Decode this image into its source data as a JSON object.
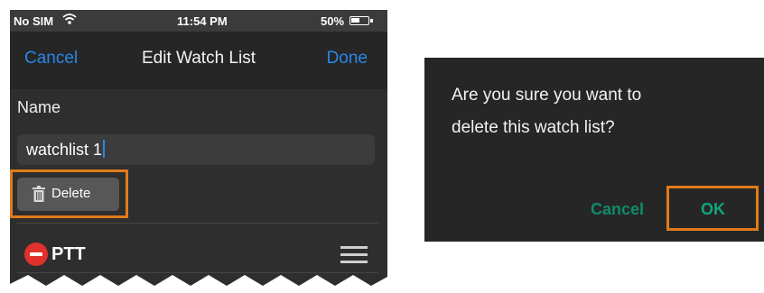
{
  "status_bar": {
    "carrier": "No SIM",
    "time": "11:54 PM",
    "battery": "50%"
  },
  "nav": {
    "cancel_label": "Cancel",
    "title": "Edit Watch List",
    "done_label": "Done"
  },
  "form": {
    "name_label": "Name",
    "name_value": "watchlist 1",
    "delete_label": "Delete"
  },
  "list": {
    "items": [
      {
        "label": "PTT"
      }
    ]
  },
  "dialog": {
    "message_line1": "Are you sure you want to",
    "message_line2": "delete this watch list?",
    "cancel_label": "Cancel",
    "ok_label": "OK"
  },
  "colors": {
    "accent_blue": "#2a86e8",
    "highlight_orange": "#e07b1a",
    "delete_red": "#e0312b",
    "dialog_green": "#0fa57a"
  },
  "icons": [
    "wifi-icon",
    "battery-icon",
    "trash-icon",
    "minus-circle-icon",
    "reorder-icon"
  ]
}
